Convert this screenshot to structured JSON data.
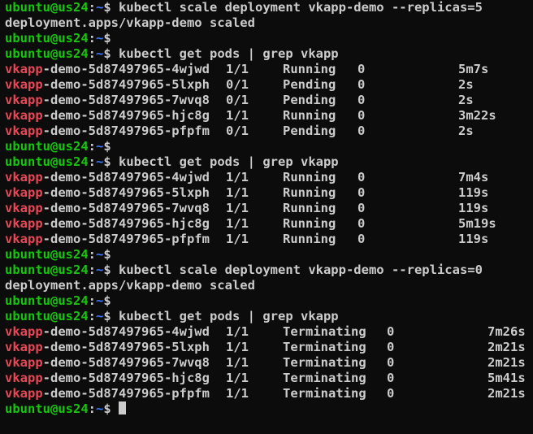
{
  "prompt": {
    "user": "ubuntu",
    "at": "@",
    "host": "us24",
    "colon": ":",
    "path": "~",
    "symbol": "$"
  },
  "lines": [
    {
      "type": "prompt",
      "command": "kubectl scale deployment vkapp-demo --replicas=5"
    },
    {
      "type": "output",
      "text": "deployment.apps/vkapp-demo scaled"
    },
    {
      "type": "prompt",
      "command": ""
    },
    {
      "type": "prompt",
      "command": "kubectl get pods | grep vkapp"
    },
    {
      "type": "pod",
      "match": "vkapp",
      "rest": "-demo-5d87497965-4wjwd",
      "ready": "1/1",
      "status": "Running",
      "restarts": "0",
      "age": "5m7s",
      "layout": "a"
    },
    {
      "type": "pod",
      "match": "vkapp",
      "rest": "-demo-5d87497965-5lxph",
      "ready": "0/1",
      "status": "Pending",
      "restarts": "0",
      "age": "2s",
      "layout": "a"
    },
    {
      "type": "pod",
      "match": "vkapp",
      "rest": "-demo-5d87497965-7wvq8",
      "ready": "0/1",
      "status": "Pending",
      "restarts": "0",
      "age": "2s",
      "layout": "a"
    },
    {
      "type": "pod",
      "match": "vkapp",
      "rest": "-demo-5d87497965-hjc8g",
      "ready": "1/1",
      "status": "Running",
      "restarts": "0",
      "age": "3m22s",
      "layout": "a"
    },
    {
      "type": "pod",
      "match": "vkapp",
      "rest": "-demo-5d87497965-pfpfm",
      "ready": "0/1",
      "status": "Pending",
      "restarts": "0",
      "age": "2s",
      "layout": "a"
    },
    {
      "type": "prompt",
      "command": ""
    },
    {
      "type": "prompt",
      "command": "kubectl get pods | grep vkapp"
    },
    {
      "type": "pod",
      "match": "vkapp",
      "rest": "-demo-5d87497965-4wjwd",
      "ready": "1/1",
      "status": "Running",
      "restarts": "0",
      "age": "7m4s",
      "layout": "a"
    },
    {
      "type": "pod",
      "match": "vkapp",
      "rest": "-demo-5d87497965-5lxph",
      "ready": "1/1",
      "status": "Running",
      "restarts": "0",
      "age": "119s",
      "layout": "a"
    },
    {
      "type": "pod",
      "match": "vkapp",
      "rest": "-demo-5d87497965-7wvq8",
      "ready": "1/1",
      "status": "Running",
      "restarts": "0",
      "age": "119s",
      "layout": "a"
    },
    {
      "type": "pod",
      "match": "vkapp",
      "rest": "-demo-5d87497965-hjc8g",
      "ready": "1/1",
      "status": "Running",
      "restarts": "0",
      "age": "5m19s",
      "layout": "a"
    },
    {
      "type": "pod",
      "match": "vkapp",
      "rest": "-demo-5d87497965-pfpfm",
      "ready": "1/1",
      "status": "Running",
      "restarts": "0",
      "age": "119s",
      "layout": "a"
    },
    {
      "type": "prompt",
      "command": ""
    },
    {
      "type": "prompt",
      "command": "kubectl scale deployment vkapp-demo --replicas=0"
    },
    {
      "type": "output",
      "text": "deployment.apps/vkapp-demo scaled"
    },
    {
      "type": "prompt",
      "command": ""
    },
    {
      "type": "prompt",
      "command": "kubectl get pods | grep vkapp"
    },
    {
      "type": "pod",
      "match": "vkapp",
      "rest": "-demo-5d87497965-4wjwd",
      "ready": "1/1",
      "status": "Terminating",
      "restarts": "0",
      "age": "7m26s",
      "layout": "b"
    },
    {
      "type": "pod",
      "match": "vkapp",
      "rest": "-demo-5d87497965-5lxph",
      "ready": "1/1",
      "status": "Terminating",
      "restarts": "0",
      "age": "2m21s",
      "layout": "b"
    },
    {
      "type": "pod",
      "match": "vkapp",
      "rest": "-demo-5d87497965-7wvq8",
      "ready": "1/1",
      "status": "Terminating",
      "restarts": "0",
      "age": "2m21s",
      "layout": "b"
    },
    {
      "type": "pod",
      "match": "vkapp",
      "rest": "-demo-5d87497965-hjc8g",
      "ready": "1/1",
      "status": "Terminating",
      "restarts": "0",
      "age": "5m41s",
      "layout": "b"
    },
    {
      "type": "pod",
      "match": "vkapp",
      "rest": "-demo-5d87497965-pfpfm",
      "ready": "1/1",
      "status": "Terminating",
      "restarts": "0",
      "age": "2m21s",
      "layout": "b"
    },
    {
      "type": "prompt",
      "command": "",
      "cursor": true
    }
  ],
  "colors": {
    "background": "#0c0c0c",
    "foreground": "#cccccc",
    "prompt_user": "#16c60c",
    "prompt_path": "#3b78ff",
    "grep_match": "#e74856"
  }
}
